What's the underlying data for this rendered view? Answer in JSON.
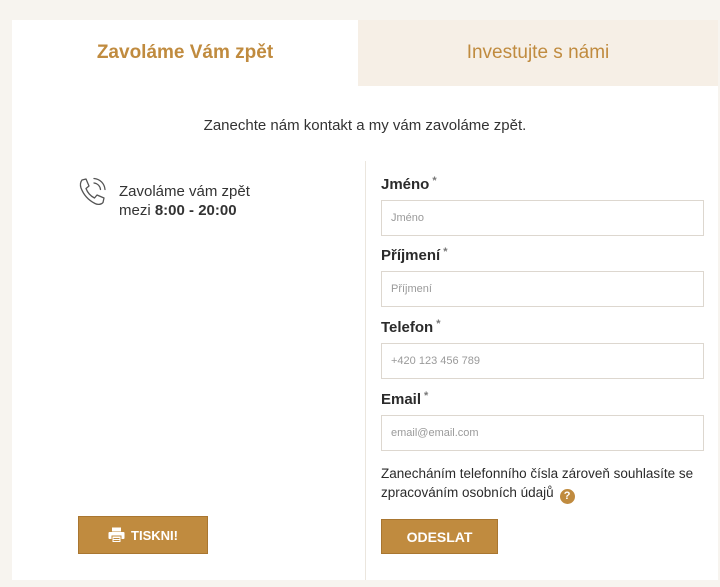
{
  "tabs": [
    {
      "label": "Zavoláme Vám zpět",
      "active": true
    },
    {
      "label": "Investujte s námi",
      "active": false
    }
  ],
  "intro_text": "Zanechte nám kontakt a my vám zavoláme zpět.",
  "info": {
    "icon": "phone-icon",
    "line1": "Zavoláme vám zpět",
    "line2_prefix": "mezi ",
    "line2_hours": "8:00 - 20:00"
  },
  "print_button": {
    "label": "TISKNI!",
    "icon": "printer-icon"
  },
  "form": {
    "first_name": {
      "label": "Jméno",
      "required_mark": "*",
      "placeholder": "Jméno",
      "value": ""
    },
    "last_name": {
      "label": "Příjmení",
      "required_mark": "*",
      "placeholder": "Příjmení",
      "value": ""
    },
    "phone": {
      "label": "Telefon",
      "required_mark": "*",
      "placeholder": "+420 123 456 789",
      "value": ""
    },
    "email": {
      "label": "Email",
      "required_mark": "*",
      "placeholder": "email@email.com",
      "value": ""
    },
    "consent_text": "Zanecháním telefonního čísla zároveň souhlasíte se zpracováním osobních údajů",
    "help_icon": "question-icon",
    "help_glyph": "?",
    "submit_label": "ODESLAT"
  },
  "colors": {
    "accent": "#c08b3f",
    "inactive_tab_bg": "#f6efe6",
    "page_bg": "#f7f4ef"
  }
}
